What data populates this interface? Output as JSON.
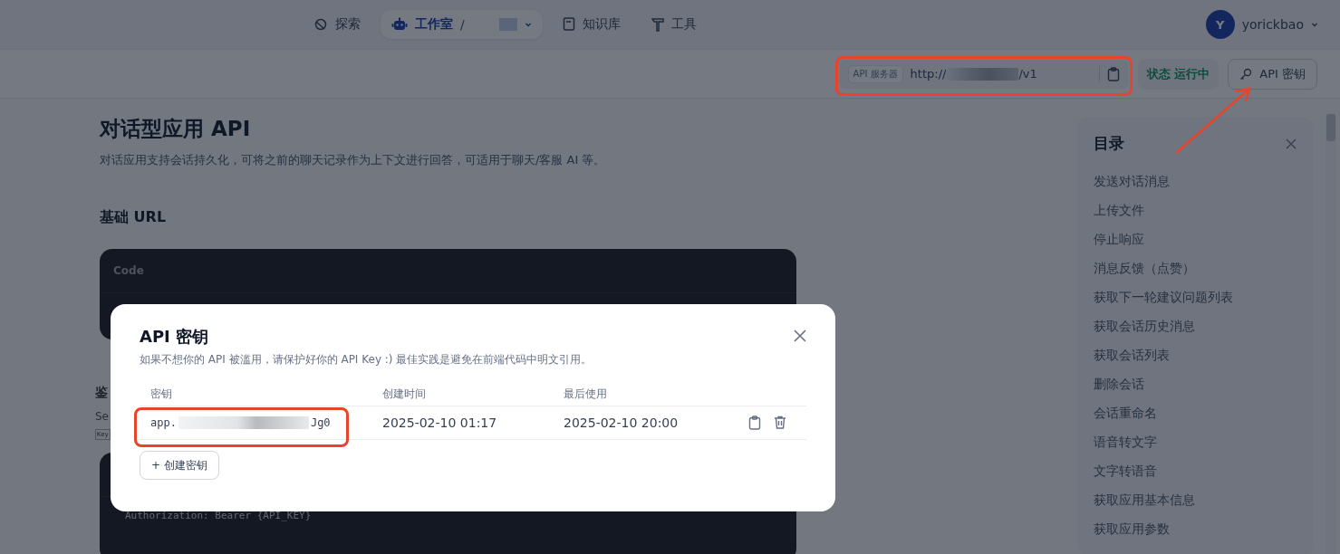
{
  "nav": {
    "items": [
      {
        "label": "探索",
        "selected": false
      },
      {
        "label": "工作室",
        "selected": true,
        "separator": "/"
      },
      {
        "label": "知识库",
        "selected": false
      },
      {
        "label": "工具",
        "selected": false
      }
    ],
    "user": {
      "avatar": "Y",
      "name": "yorickbao"
    }
  },
  "toolbar": {
    "server_label": "API 服务器",
    "server_url_start": "http://",
    "server_url_end": "/v1",
    "status_label": "状态",
    "status_value": "运行中",
    "key_button": "API 密钥"
  },
  "doc": {
    "title": "对话型应用 API",
    "description": "对话应用支持会话持久化，可将之前的聊天记录作为上下文进行回答，可适用于聊天/客服 AI 等。",
    "base_url_heading": "基础 URL",
    "code_header": "Code",
    "auth_heading": "鉴",
    "auth_text": "Se",
    "auth_key_tag": "Key",
    "auth_code": "Authorization: Bearer {API_KEY}"
  },
  "toc": {
    "title": "目录",
    "items": [
      "发送对话消息",
      "上传文件",
      "停止响应",
      "消息反馈（点赞）",
      "获取下一轮建议问题列表",
      "获取会话历史消息",
      "获取会话列表",
      "删除会话",
      "会话重命名",
      "语音转文字",
      "文字转语音",
      "获取应用基本信息",
      "获取应用参数"
    ]
  },
  "modal": {
    "title": "API 密钥",
    "description": "如果不想你的 API 被滥用，请保护好你的 API Key :) 最佳实践是避免在前端代码中明文引用。",
    "columns": [
      "密钥",
      "创建时间",
      "最后使用"
    ],
    "rows": [
      {
        "key_start": "app.",
        "key_end": "Jg0",
        "created": "2025-02-10 01:17",
        "last_used": "2025-02-10 20:00"
      }
    ],
    "create_button": "+ 创建密钥"
  }
}
